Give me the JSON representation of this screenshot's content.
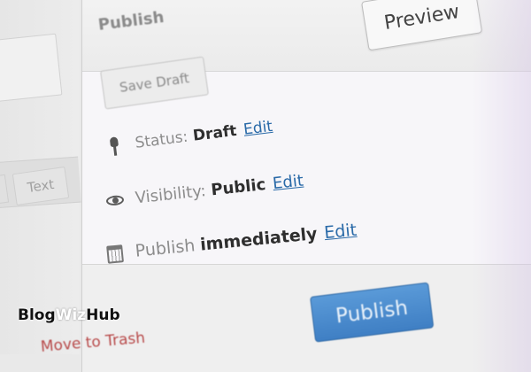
{
  "left_panel": {
    "toolbar_tab": "Text"
  },
  "publish_box": {
    "title": "Publish",
    "preview_label": "Preview",
    "save_draft_label": "Save Draft",
    "status": {
      "label": "Status:",
      "value": "Draft",
      "edit": "Edit"
    },
    "visibility": {
      "label": "Visibility:",
      "value": "Public",
      "edit": "Edit"
    },
    "schedule": {
      "label": "Publish",
      "value": "immediately",
      "edit": "Edit"
    },
    "trash_label": "Move to Trash",
    "publish_label": "Publish"
  },
  "watermark": {
    "part1": "Blog",
    "part2": "Wiz",
    "part3": "Hub"
  },
  "colors": {
    "publish_button": "#4a8bd0",
    "link": "#2a6aa8",
    "trash_link": "#b84a4a"
  },
  "icons": [
    "pin-icon",
    "eye-icon",
    "calendar-icon"
  ]
}
